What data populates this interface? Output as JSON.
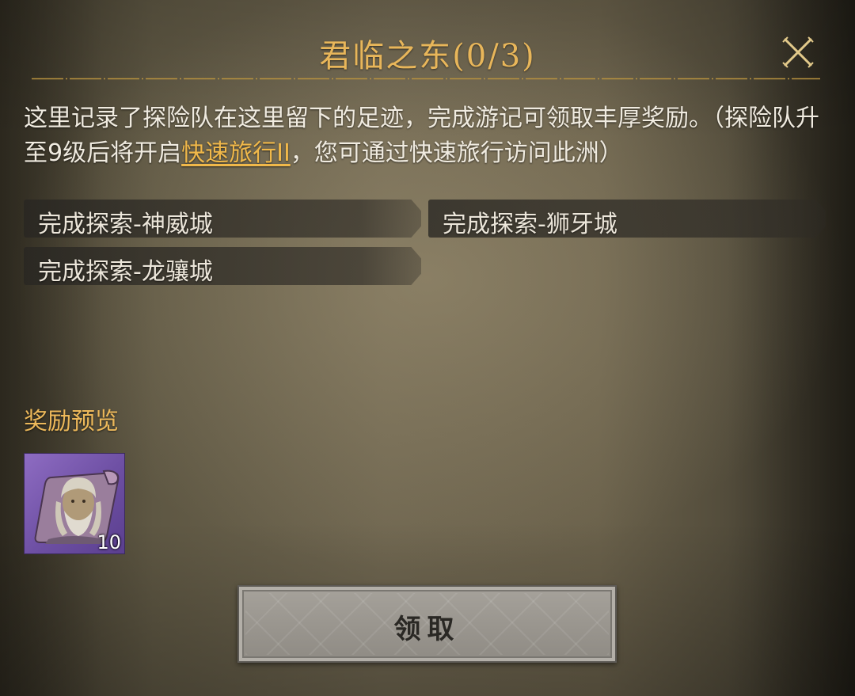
{
  "header": {
    "title": "君临之东(0/3)",
    "close_icon": "close-x-icon"
  },
  "description": {
    "text_before": "这里记录了探险队在这里留下的足迹，完成游记可领取丰厚奖励。（探险队升至9级后将开启",
    "link": "快速旅行II",
    "text_after": "，您可通过快速旅行访问此洲）"
  },
  "tasks": [
    {
      "label": "完成探索-神威城"
    },
    {
      "label": "完成探索-狮牙城"
    },
    {
      "label": "完成探索-龙骧城"
    }
  ],
  "rewards": {
    "title": "奖励预览",
    "items": [
      {
        "icon": "scroll-portrait-icon",
        "count": "10",
        "rarity_color": "#7b5bb3"
      }
    ]
  },
  "claim_button": {
    "label": "领取",
    "state": "disabled"
  },
  "colors": {
    "title": "#e8b65a",
    "link": "#f0b84a",
    "reward_title": "#ecb85a",
    "text": "#f0ebe0"
  }
}
